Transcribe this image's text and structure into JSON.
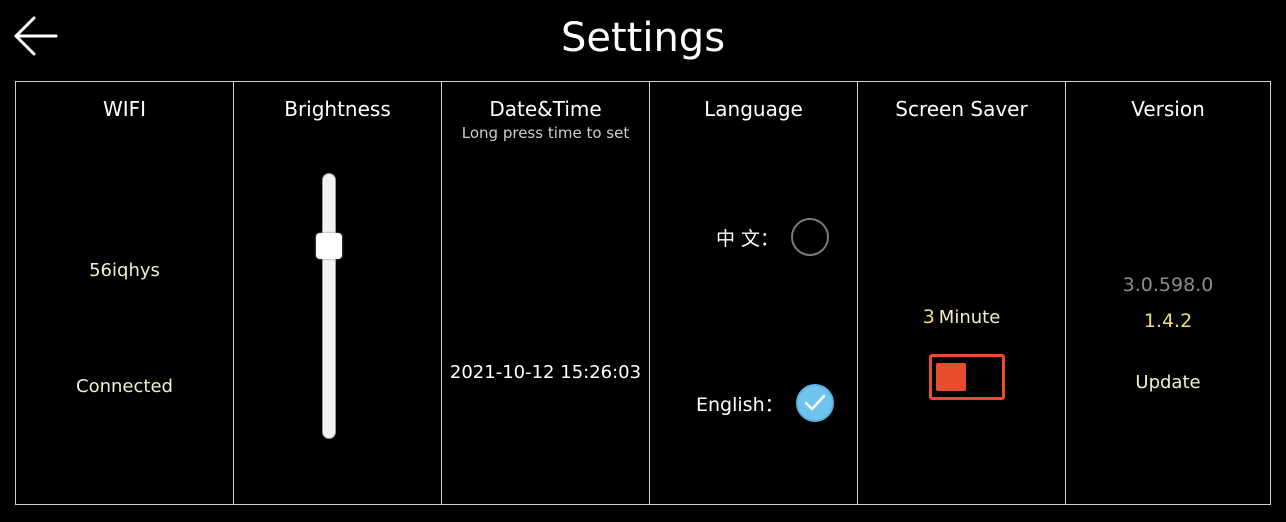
{
  "header": {
    "title": "Settings",
    "back_icon": "arrow-left-icon"
  },
  "wifi": {
    "label": "WIFI",
    "ssid": "56iqhys",
    "status": "Connected"
  },
  "brightness": {
    "label": "Brightness",
    "level": 0.75
  },
  "datetime": {
    "label": "Date&Time",
    "hint": "Long press time to set",
    "value": "2021-10-12 15:26:03"
  },
  "language": {
    "label": "Language",
    "options": [
      {
        "label": "中 文：",
        "selected": false
      },
      {
        "label": "English：",
        "selected": true
      }
    ],
    "check_icon": "checkmark-icon"
  },
  "screen_saver": {
    "label": "Screen Saver",
    "minutes": "3",
    "unit": "Minute",
    "enabled": false,
    "accent_color": "#e84d2e"
  },
  "version": {
    "label": "Version",
    "system_version": "3.0.598.0",
    "app_version": "1.4.2",
    "update_label": "Update"
  },
  "colors": {
    "background": "#000000",
    "border": "#cfcfcf",
    "highlight_yellow": "#f4df6a",
    "check_blue": "#6fc4ef"
  }
}
